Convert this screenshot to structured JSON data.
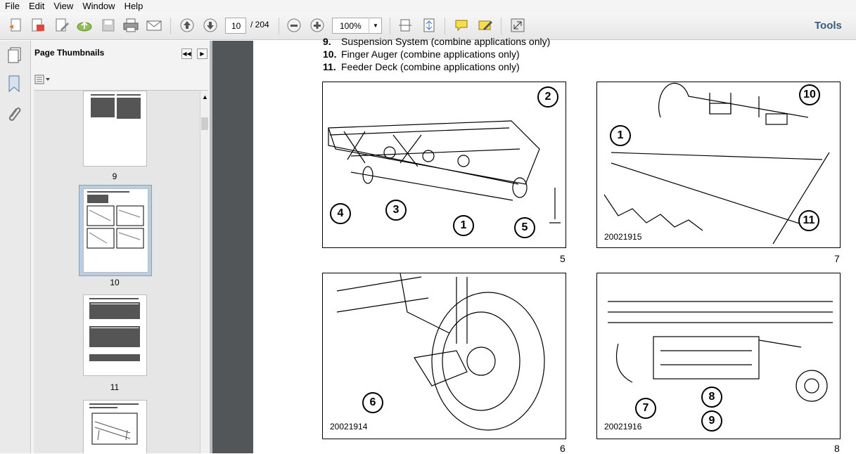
{
  "menu": [
    "File",
    "Edit",
    "View",
    "Window",
    "Help"
  ],
  "toolbar": {
    "page_current": "10",
    "page_total": "/ 204",
    "zoom": "100%",
    "tools_label": "Tools"
  },
  "panel": {
    "title": "Page Thumbnails"
  },
  "thumbnails": [
    {
      "label": "9"
    },
    {
      "label": "10"
    },
    {
      "label": "11"
    },
    {
      "label": ""
    }
  ],
  "document": {
    "list": [
      {
        "num": "9.",
        "text": "Suspension System (combine applications only)"
      },
      {
        "num": "10.",
        "text": "Finger Auger (combine applications only)"
      },
      {
        "num": "11.",
        "text": "Feeder Deck (combine applications only)"
      }
    ],
    "figures": [
      {
        "number": "5",
        "code": "",
        "callouts": [
          "2",
          "4",
          "3",
          "1",
          "5"
        ]
      },
      {
        "number": "7",
        "code": "20021915",
        "callouts": [
          "10",
          "1",
          "11"
        ]
      },
      {
        "number": "6",
        "code": "20021914",
        "callouts": [
          "6"
        ]
      },
      {
        "number": "8",
        "code": "20021916",
        "callouts": [
          "7",
          "8",
          "9"
        ]
      }
    ]
  },
  "icons": [
    "create-pdf-icon",
    "export-pdf-icon",
    "edit-pdf-icon",
    "cloud-upload-icon",
    "save-icon",
    "print-icon",
    "email-icon",
    "page-up-icon",
    "page-down-icon",
    "zoom-out-icon",
    "zoom-in-icon",
    "fit-width-icon",
    "fit-page-icon",
    "comment-icon",
    "sign-icon",
    "fullscreen-icon",
    "page-thumbnails-icon",
    "bookmark-icon",
    "attachment-icon"
  ]
}
